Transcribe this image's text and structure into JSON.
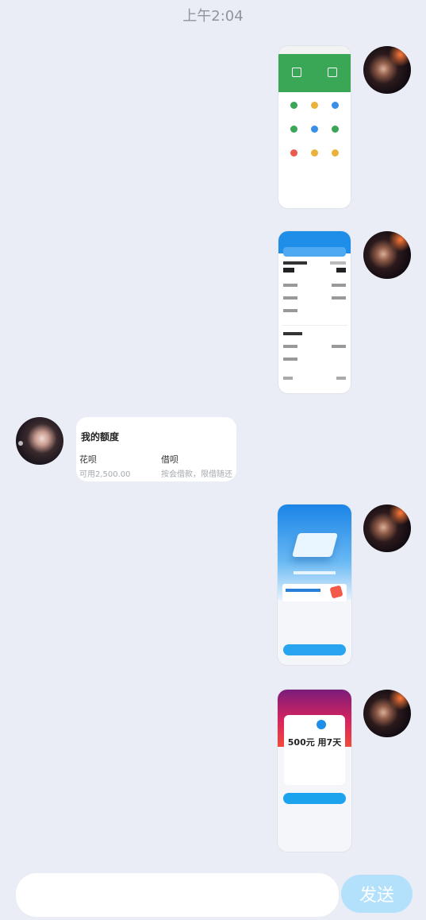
{
  "chat": {
    "timestamp": "上午2:04"
  },
  "messages": {
    "limit_card": {
      "title": "我的额度",
      "huabei_name": "花呗",
      "huabei_sub": "可用2,500.00",
      "jiebei_name": "借呗",
      "jiebei_sub": "按会借款，限借随还"
    },
    "promo_shot": {
      "price_text": "500元 用7天"
    }
  },
  "composer": {
    "input_value": "",
    "send_label": "发送"
  },
  "colors": {
    "background": "#eaedf5",
    "send_button": "#b3e1fb",
    "wallet_green": "#3aa757",
    "account_blue": "#1e8ee8"
  }
}
